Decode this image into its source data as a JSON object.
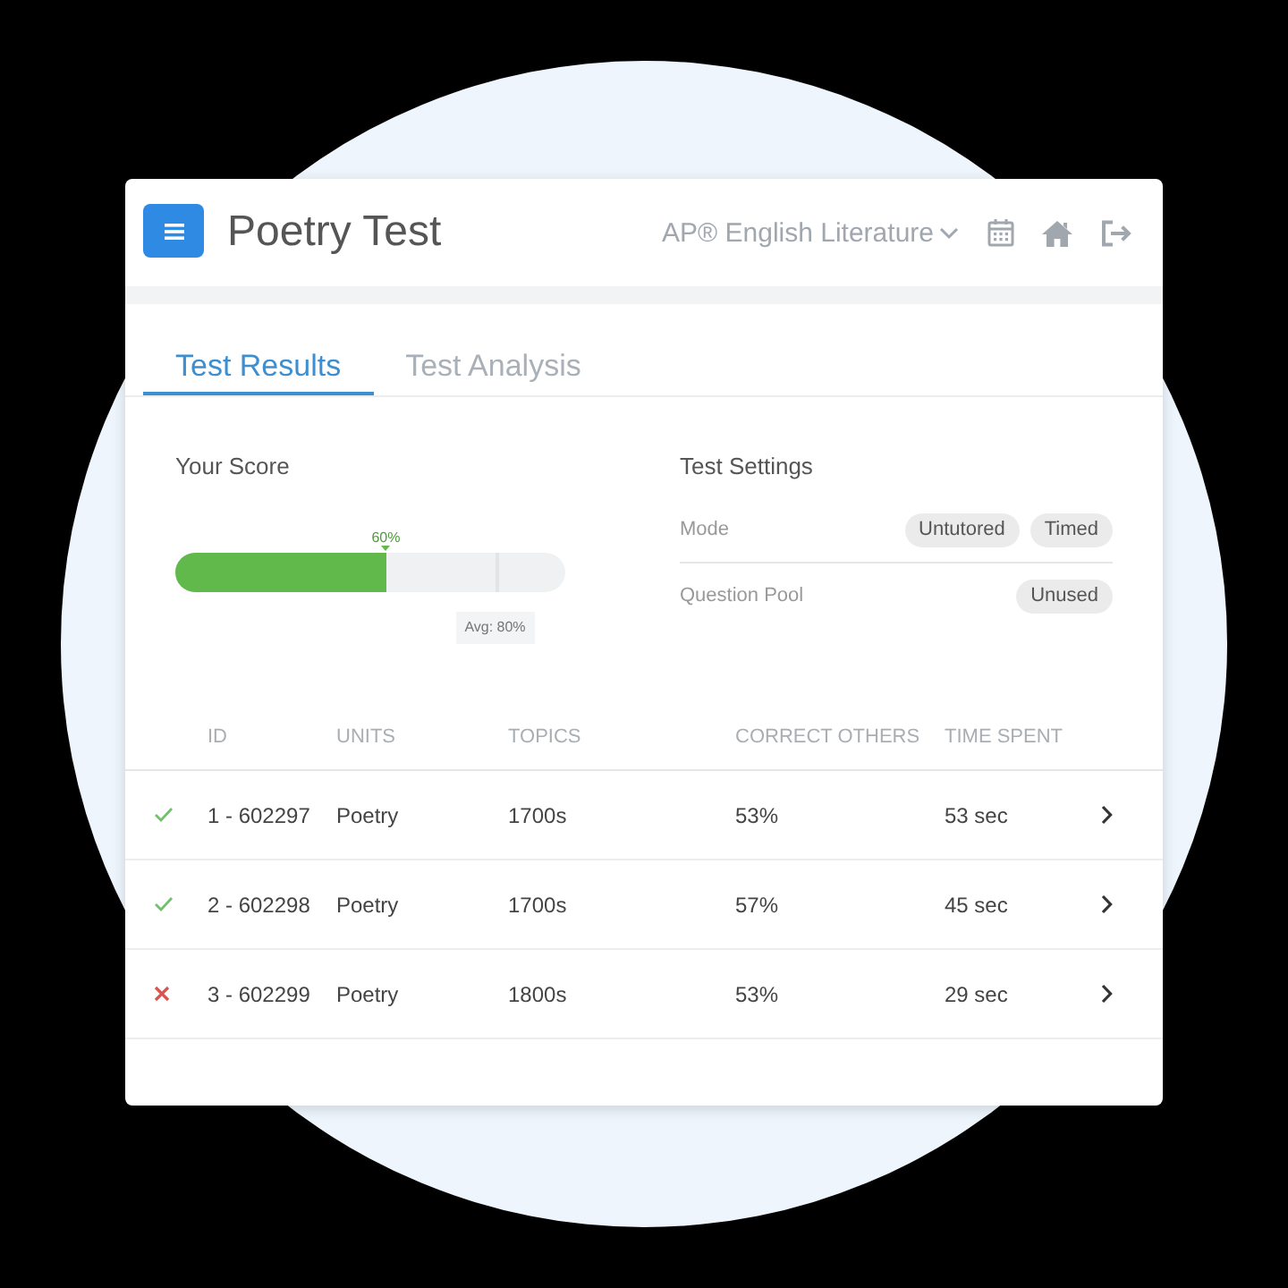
{
  "header": {
    "title": "Poetry Test",
    "course": "AP® English Literature"
  },
  "tabs": [
    {
      "label": "Test Results",
      "selected": true
    },
    {
      "label": "Test Analysis",
      "selected": false
    }
  ],
  "score": {
    "title": "Your Score",
    "level": 0.54,
    "label": "60%",
    "average": {
      "level": 0.82,
      "label": "Avg: 80%"
    }
  },
  "settings": {
    "title": "Test Settings",
    "rows": [
      {
        "label": "Mode",
        "chips": [
          "Untutored",
          "Timed"
        ]
      },
      {
        "label": "Question Pool",
        "chips": [
          "Unused"
        ]
      }
    ]
  },
  "table": {
    "columns": [
      "ID",
      "UNITS",
      "TOPICS",
      "CORRECT OTHERS",
      "TIME SPENT"
    ],
    "rows": [
      {
        "correct": true,
        "cells": [
          "1 - 602297",
          "Poetry",
          "1700s",
          "53%",
          "53 sec"
        ]
      },
      {
        "correct": true,
        "cells": [
          "2 - 602298",
          "Poetry",
          "1700s",
          "57%",
          "45 sec"
        ]
      },
      {
        "correct": false,
        "cells": [
          "3 - 602299",
          "Poetry",
          "1800s",
          "53%",
          "29 sec"
        ]
      }
    ]
  }
}
